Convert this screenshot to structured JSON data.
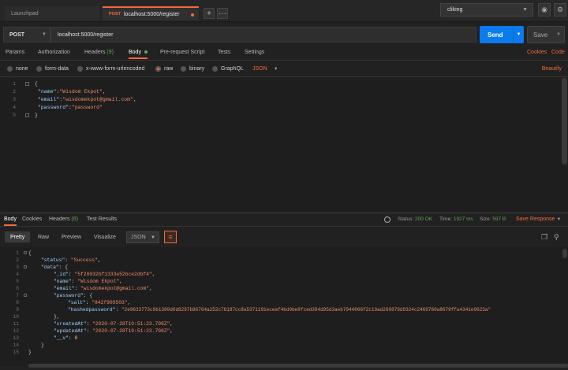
{
  "tabs": [
    {
      "label": "Launchpad"
    },
    {
      "method": "POST",
      "label": "localhost:5000/register"
    }
  ],
  "env": {
    "selected": "cliking"
  },
  "request": {
    "method": "POST",
    "url": "localhost:5000/register",
    "send_label": "Send",
    "save_label": "Save"
  },
  "req_tabs": {
    "params": "Params",
    "authorization": "Authorization",
    "headers": "Headers",
    "headers_count": "(9)",
    "body": "Body",
    "prerequest": "Pre-request Script",
    "tests": "Tests",
    "settings": "Settings",
    "cookies": "Cookies",
    "code": "Code"
  },
  "body_types": {
    "none": "none",
    "form_data": "form-data",
    "urlencoded": "x-www-form-urlencoded",
    "raw": "raw",
    "binary": "binary",
    "graphql": "GraphQL",
    "format": "JSON",
    "beautify": "Beautify"
  },
  "request_body": {
    "line_numbers": [
      "1",
      "2",
      "3",
      "4",
      "5"
    ],
    "name_key": "\"name\"",
    "name_val": "\"Wisdom Ekpot\"",
    "email_key": "\"email\"",
    "email_val": "\"wisdomekpot@gmail.com\"",
    "password_key": "\"password\"",
    "password_val": "\"password\""
  },
  "response_tabs": {
    "body": "Body",
    "cookies": "Cookies",
    "headers": "Headers",
    "headers_count": "(6)",
    "test_results": "Test Results"
  },
  "response_status": {
    "status_label": "Status:",
    "status_value": "200 OK",
    "time_label": "Time:",
    "time_value": "1927 ms",
    "size_label": "Size:",
    "size_value": "597 B",
    "save_response": "Save Response"
  },
  "response_toolbar": {
    "pretty": "Pretty",
    "raw": "Raw",
    "preview": "Preview",
    "visualize": "Visualize",
    "format": "JSON"
  },
  "response_body": {
    "line_numbers": [
      "1",
      "2",
      "3",
      "4",
      "5",
      "6",
      "7",
      "8",
      "9",
      "10",
      "11",
      "12",
      "13",
      "14",
      "15"
    ],
    "status_key": "\"status\"",
    "status_val": "\"Success\"",
    "data_key": "\"data\"",
    "id_key": "\"_id\"",
    "id_val": "\"5f20032bf1333e52bce2dbf4\"",
    "name_key": "\"name\"",
    "name_val": "\"Wisdom Ekpot\"",
    "email_key": "\"email\"",
    "email_val": "\"wisdomekpot@gmail.com\"",
    "password_key": "\"password\"",
    "salt_key": "\"salt\"",
    "salt_val": "\"842f909503\"",
    "hashed_key": "\"hashedpassword\"",
    "hashed_val": "\"2e9633773c9b1380d0d8297b96764a252c76187cc8a5371191eceaf4bd9be8fced384d95d3aeb7944066f2c19ad260879d8324c2469760a8679ffa4341e9623a\"",
    "created_key": "\"createdAt\"",
    "created_val": "\"2020-07-28T10:51:23.798Z\"",
    "updated_key": "\"updatedAt\"",
    "updated_val": "\"2020-07-28T10:51:23.798Z\"",
    "v_key": "\"__v\"",
    "v_val": "0"
  }
}
